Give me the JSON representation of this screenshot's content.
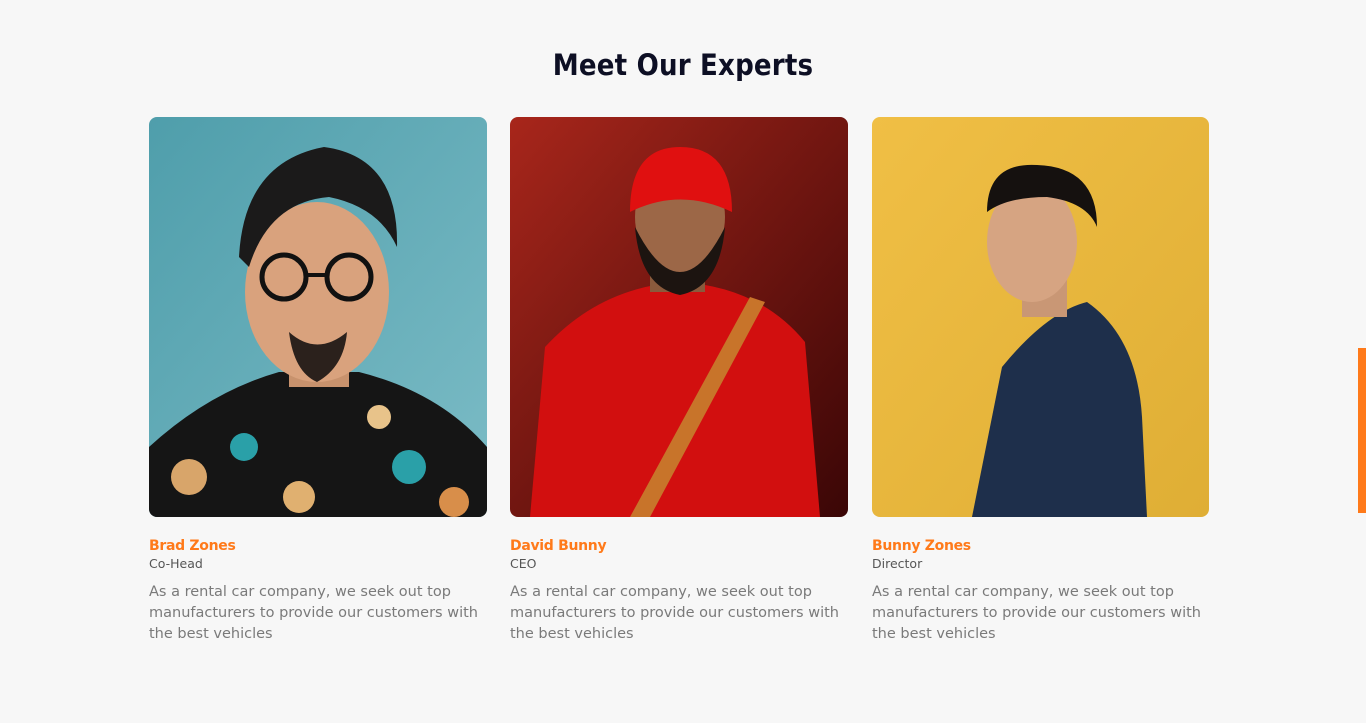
{
  "section": {
    "title": "Meet Our Experts"
  },
  "experts": [
    {
      "name": "Brad Zones",
      "role": "Co-Head",
      "description": "As a rental car company, we seek out top manufacturers to provide our customers with the best vehicles",
      "photo_background": "#62a8b6"
    },
    {
      "name": "David Bunny",
      "role": "CEO",
      "description": "As a rental car company, we seek out top manufacturers to provide our customers with the best vehicles",
      "photo_background": "#a4231a"
    },
    {
      "name": "Bunny Zones",
      "role": "Director",
      "description": "As a rental car company, we seek out top manufacturers to provide our customers with the best vehicles",
      "photo_background": "#e8b83c"
    }
  ],
  "colors": {
    "accent": "#ff7a1a",
    "title": "#0d0f24",
    "body_text": "#7a7a7a",
    "background": "#f7f7f7"
  }
}
